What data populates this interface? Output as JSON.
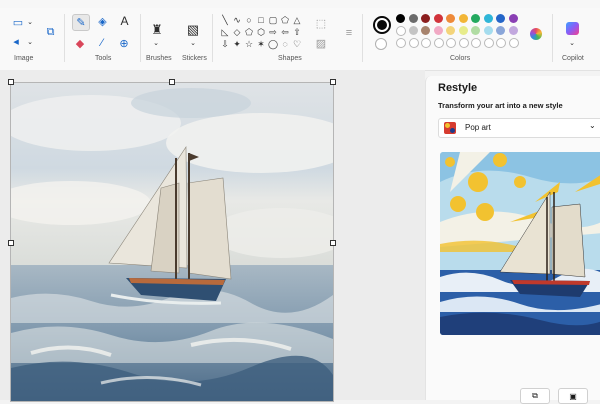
{
  "ribbon": {
    "groups": {
      "image": "Image",
      "tools": "Tools",
      "brushes": "Brushes",
      "stickers": "Stickers",
      "shapes": "Shapes",
      "colors": "Colors",
      "copilot": "Copilot"
    },
    "text_tool_glyph": "A",
    "selected_tool": "pencil",
    "primary_color": "#0a0a0a",
    "palette_row1": [
      "#000000",
      "#6b6b6b",
      "#8b1e1e",
      "#d1343b",
      "#ee8a3a",
      "#f2b637",
      "#24a95f",
      "#2fb6d8",
      "#2566c9",
      "#8a3fb4"
    ],
    "palette_row2": [
      "#ffffff",
      "#c4c4c4",
      "#a7836d",
      "#f1a9c4",
      "#f4d47a",
      "#e7ec8b",
      "#b0dca3",
      "#a4dcee",
      "#8aa6d9",
      "#c2a8de"
    ],
    "palette_row3_empty_count": 10
  },
  "panel": {
    "title": "Restyle",
    "subtitle": "Transform your art into a new style",
    "style_selected": "Pop art"
  }
}
